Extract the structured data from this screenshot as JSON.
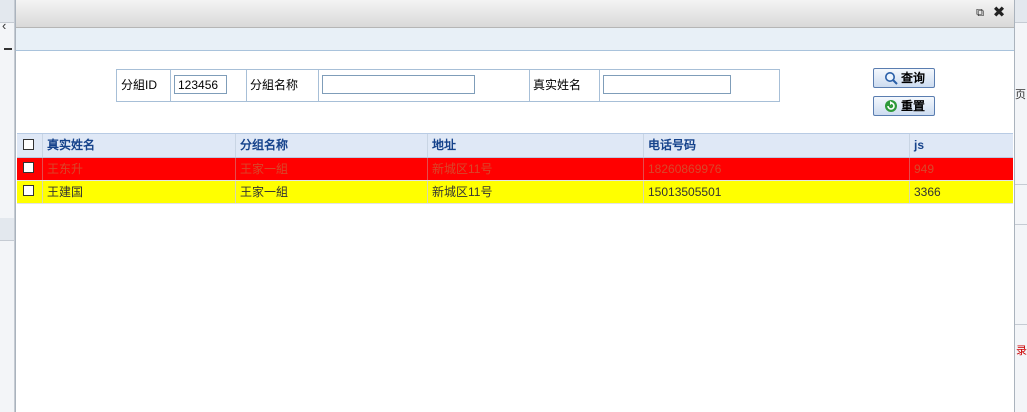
{
  "window": {
    "restore_icon": "restore-icon",
    "close_icon": "close-icon"
  },
  "search": {
    "group_id_label": "分組ID",
    "group_id_value": "123456",
    "group_name_label": "分組名称",
    "group_name_value": "",
    "real_name_label": "真实姓名",
    "real_name_value": ""
  },
  "buttons": {
    "query_label": "查询",
    "reset_label": "重置"
  },
  "table": {
    "columns": [
      "真实姓名",
      "分组名称",
      "地址",
      "电话号码",
      "js"
    ],
    "rows": [
      {
        "name": "王东升",
        "group": "王家一組",
        "address": "新城区11号",
        "phone": "18260869976",
        "js": "949",
        "highlight": "#ff0000"
      },
      {
        "name": "王建国",
        "group": "王家一組",
        "address": "新城区11号",
        "phone": "15013505501",
        "js": "3366",
        "highlight": "#ffff00"
      }
    ]
  },
  "background": {
    "right_fragment_text": "录",
    "right_fragment_top": "页"
  }
}
